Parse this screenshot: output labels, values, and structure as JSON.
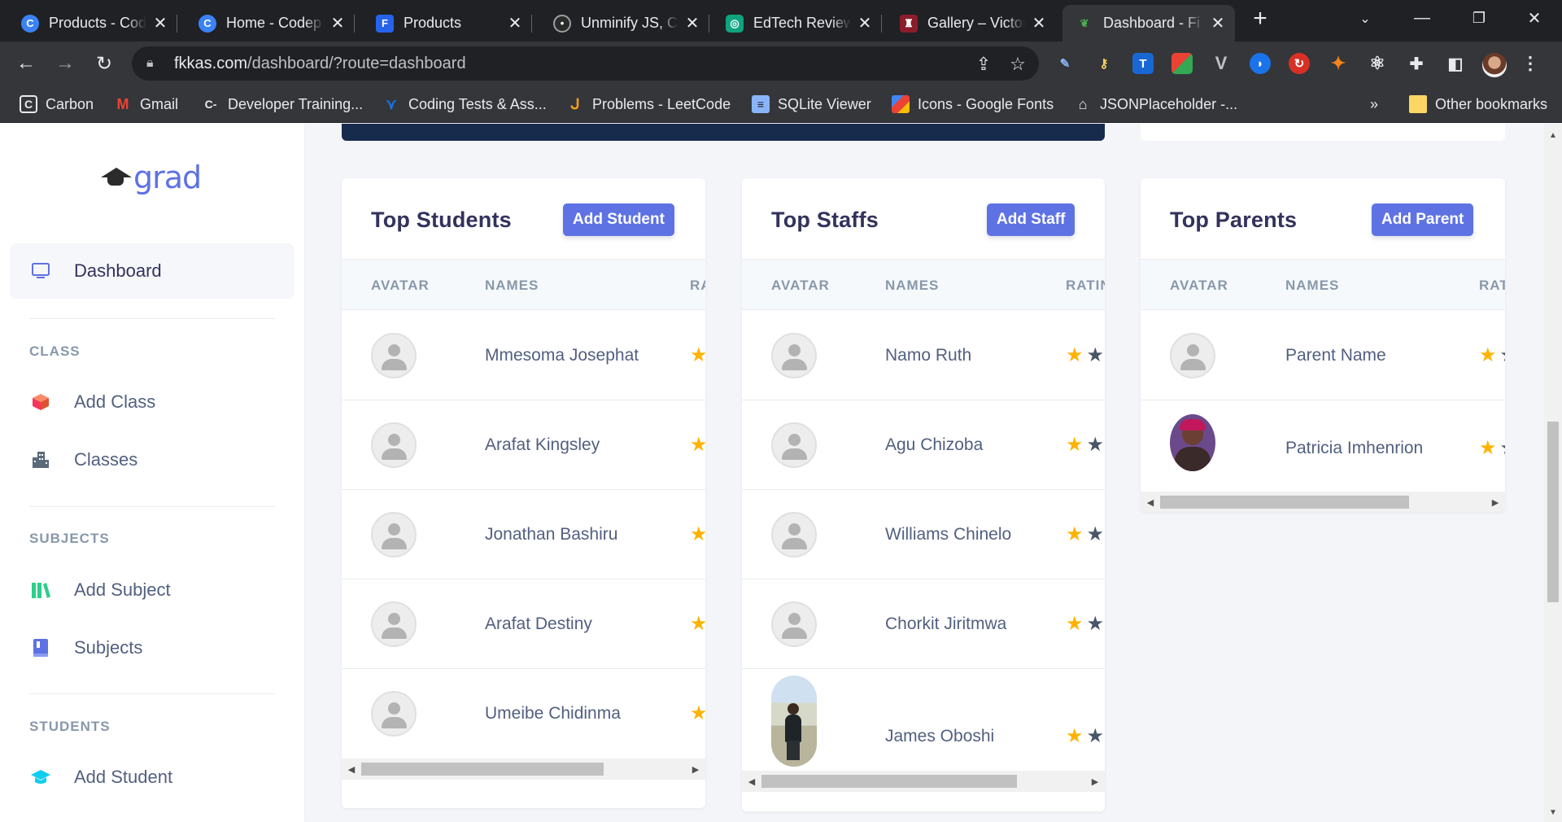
{
  "browser": {
    "tabs": [
      {
        "title": "Products - Cod",
        "icon": "codepen-c-icon",
        "color": "#3b82f6"
      },
      {
        "title": "Home - Codep",
        "icon": "codepen-c-icon",
        "color": "#3b82f6"
      },
      {
        "title": "Products",
        "icon": "framer-f-icon",
        "color": "#3b82f6"
      },
      {
        "title": "Unminify JS, C",
        "icon": "robot-icon",
        "color": "#9aa0a6"
      },
      {
        "title": "EdTech Review",
        "icon": "openai-icon",
        "color": "#10a37f"
      },
      {
        "title": "Gallery – Victor",
        "icon": "shield-crest-icon",
        "color": "#8b1c2b"
      },
      {
        "title": "Dashboard - Fi",
        "icon": "grad-leaf-icon",
        "color": "#4caf50"
      }
    ],
    "new_tab": "+",
    "address": {
      "host": "fkkas.com",
      "path": "/dashboard/?route=dashboard"
    },
    "bookmarks": [
      {
        "label": "Carbon",
        "icon": "carbon-icon"
      },
      {
        "label": "Gmail",
        "icon": "gmail-icon"
      },
      {
        "label": "Developer Training...",
        "icon": "dev-training-icon"
      },
      {
        "label": "Coding Tests & Ass...",
        "icon": "coding-tests-icon"
      },
      {
        "label": "Problems - LeetCode",
        "icon": "leetcode-icon"
      },
      {
        "label": "SQLite Viewer",
        "icon": "sqlite-icon"
      },
      {
        "label": "Icons - Google Fonts",
        "icon": "google-fonts-icon"
      },
      {
        "label": "JSONPlaceholder -...",
        "icon": "jsonplaceholder-icon"
      }
    ],
    "bookmarks_overflow": "»",
    "other_bookmarks": "Other bookmarks"
  },
  "sidebar": {
    "logo_text": "grad",
    "items": [
      {
        "label": "Dashboard",
        "icon": "monitor-icon"
      },
      {
        "label": "Add Class",
        "icon": "cube-icon"
      },
      {
        "label": "Classes",
        "icon": "building-icon"
      },
      {
        "label": "Add Subject",
        "icon": "books-icon"
      },
      {
        "label": "Subjects",
        "icon": "book-icon"
      },
      {
        "label": "Add Student",
        "icon": "graduation-cap-icon"
      }
    ],
    "headings": {
      "class": "CLASS",
      "subjects": "SUBJECTS",
      "students": "STUDENTS"
    }
  },
  "columns": {
    "avatar": "AVATAR",
    "names": "NAMES",
    "students_rating": "RA",
    "staffs_rating": "RATIN",
    "parents_rating": "RAT"
  },
  "students": {
    "title": "Top Students",
    "button": "Add Student",
    "rows": [
      {
        "name": "Mmesoma Josephat"
      },
      {
        "name": "Arafat Kingsley"
      },
      {
        "name": "Jonathan Bashiru"
      },
      {
        "name": "Arafat Destiny"
      },
      {
        "name": "Umeibe Chidinma"
      }
    ]
  },
  "staffs": {
    "title": "Top Staffs",
    "button": "Add Staff",
    "rows": [
      {
        "name": "Namo Ruth"
      },
      {
        "name": "Agu Chizoba"
      },
      {
        "name": "Williams Chinelo"
      },
      {
        "name": "Chorkit Jiritmwa"
      },
      {
        "name": "James Oboshi"
      }
    ]
  },
  "parents": {
    "title": "Top Parents",
    "button": "Add Parent",
    "rows": [
      {
        "name": "Parent Name"
      },
      {
        "name": "Patricia Imhenrion"
      }
    ]
  },
  "colors": {
    "accent": "#5e72e4",
    "banner": "#172b4d",
    "star": "#ffb300"
  }
}
